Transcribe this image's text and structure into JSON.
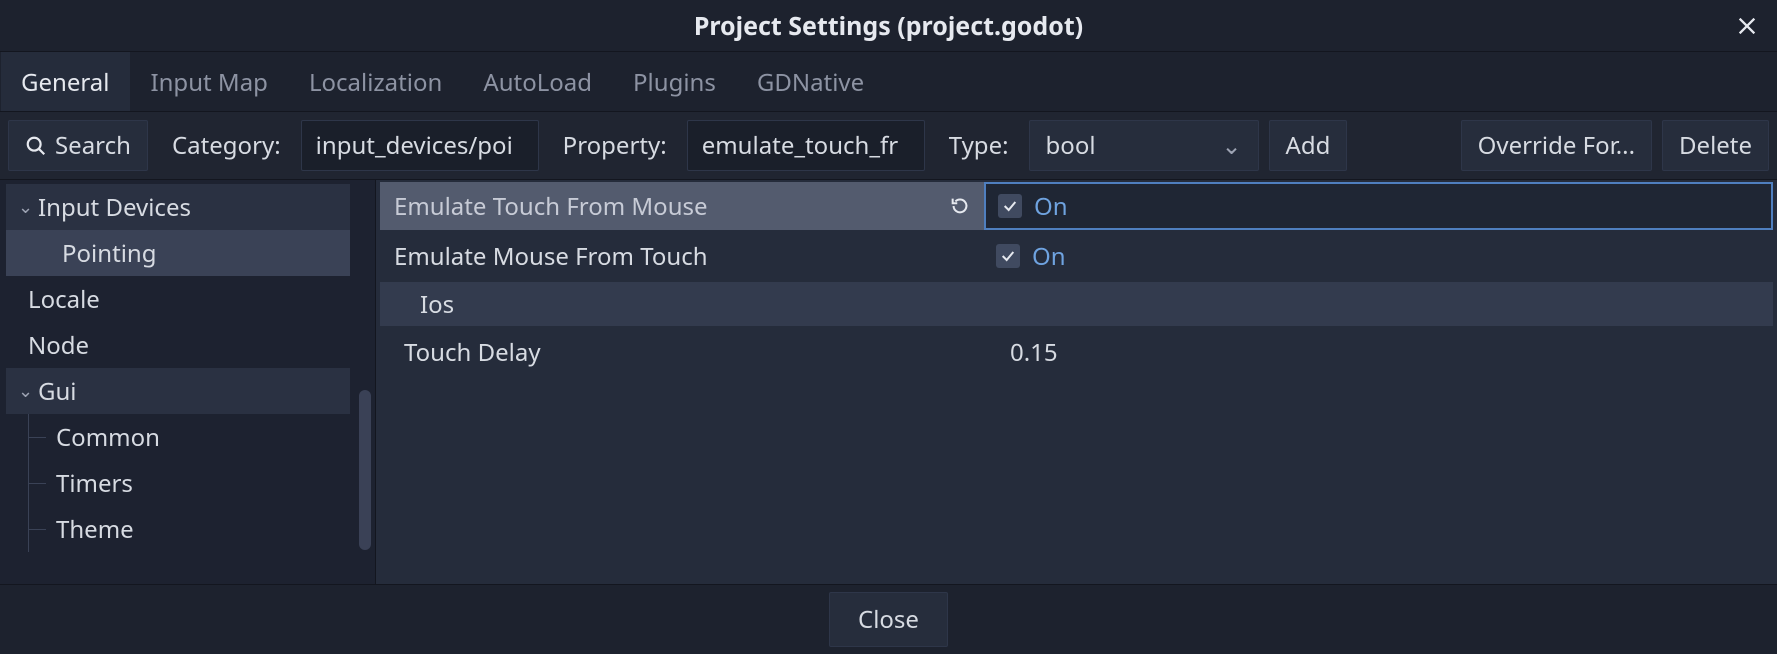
{
  "window": {
    "title": "Project Settings (project.godot)"
  },
  "tabs": {
    "general": "General",
    "input_map": "Input Map",
    "localization": "Localization",
    "autoload": "AutoLoad",
    "plugins": "Plugins",
    "gdnative": "GDNative"
  },
  "toolbar": {
    "search": "Search",
    "category_label": "Category:",
    "category_value": "input_devices/poi",
    "property_label": "Property:",
    "property_value": "emulate_touch_fr",
    "type_label": "Type:",
    "type_value": "bool",
    "add": "Add",
    "override_for": "Override For...",
    "delete": "Delete"
  },
  "tree": {
    "input_devices": "Input Devices",
    "pointing": "Pointing",
    "locale": "Locale",
    "node": "Node",
    "gui": "Gui",
    "common": "Common",
    "timers": "Timers",
    "theme": "Theme"
  },
  "props": {
    "emulate_touch_from_mouse": {
      "label": "Emulate Touch From Mouse",
      "on": "On"
    },
    "emulate_mouse_from_touch": {
      "label": "Emulate Mouse From Touch",
      "on": "On"
    },
    "ios_header": "Ios",
    "touch_delay": {
      "label": "Touch Delay",
      "value": "0.15"
    }
  },
  "footer": {
    "close": "Close"
  }
}
